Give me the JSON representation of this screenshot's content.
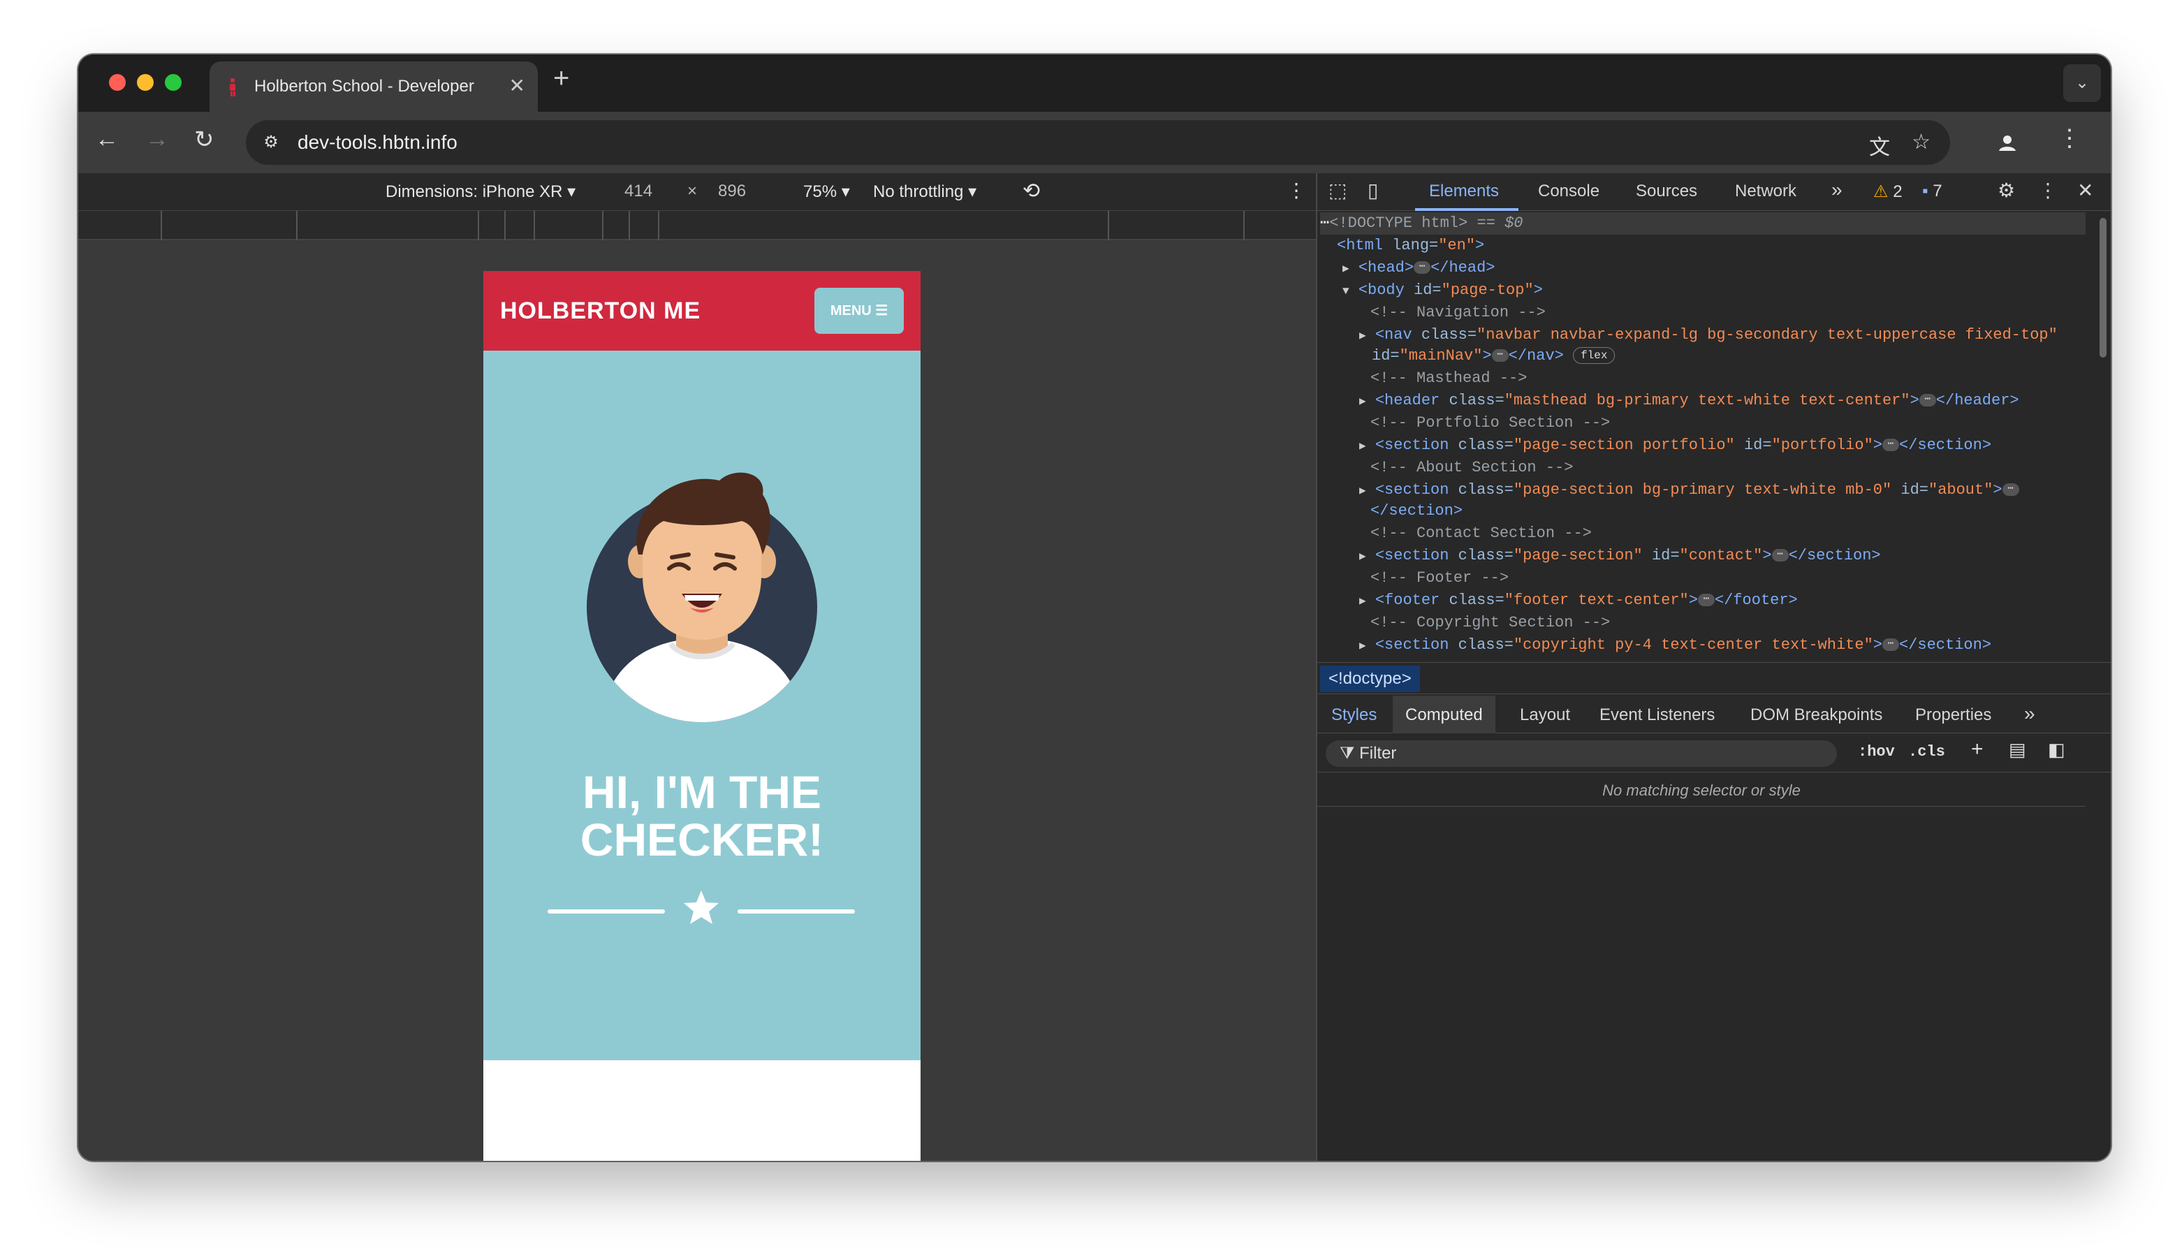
{
  "browser": {
    "tab_title": "Holberton School - Developer",
    "tab_close": "✕",
    "new_tab": "+",
    "url": "dev-tools.hbtn.info"
  },
  "emulation": {
    "dimensions": "Dimensions: iPhone XR ▾",
    "width": "414",
    "times": "×",
    "height": "896",
    "zoom": "75% ▾",
    "throttling": "No throttling ▾"
  },
  "page": {
    "brand": "HOLBERTON ME",
    "menu": "MENU ☰",
    "hero_line1": "HI, I'M THE",
    "hero_line2": "CHECKER!"
  },
  "devtools": {
    "tabs": [
      "Elements",
      "Console",
      "Sources",
      "Network"
    ],
    "more": "»",
    "warnings": "2",
    "issues": "7",
    "breadcrumb": "<!doctype>",
    "subtabs": [
      "Styles",
      "Computed",
      "Layout",
      "Event Listeners",
      "DOM Breakpoints",
      "Properties"
    ],
    "filter_placeholder": "Filter",
    "hov": ":hov",
    "cls": ".cls",
    "no_match": "No matching selector or style",
    "dom": {
      "doctype": "<!DOCTYPE html>",
      "selected_marker": " == $0",
      "html_tag": "<html",
      "html_attr": " lang=",
      "html_val": "\"en\"",
      "head": "<head>",
      "head_close": "</head>",
      "body_tag": "<body",
      "body_attr": " id=",
      "body_val": "\"page-top\"",
      "c_nav": "<!-- Navigation -->",
      "nav_tag": "<nav",
      "nav_attr": " class=",
      "nav_val": "\"navbar navbar-expand-lg bg-secondary text-uppercase fixed-top\"",
      "nav_attr2": "id=",
      "nav_val2": "\"mainNav\"",
      "nav_close": "</nav>",
      "flex": "flex",
      "c_mast": "<!-- Masthead -->",
      "header_tag": "<header",
      "header_attr": " class=",
      "header_val": "\"masthead bg-primary text-white text-center\"",
      "header_close": "</header>",
      "c_port": "<!-- Portfolio Section -->",
      "port_tag": "<section",
      "port_attr": " class=",
      "port_val": "\"page-section portfolio\"",
      "port_attr2": " id=",
      "port_val2": "\"portfolio\"",
      "section_close": "</section>",
      "c_about": "<!-- About Section -->",
      "about_tag": "<section",
      "about_attr": " class=",
      "about_val": "\"page-section bg-primary text-white mb-0\"",
      "about_attr2": " id=",
      "about_val2": "\"about\"",
      "about_close": "</section>",
      "c_contact": "<!-- Contact Section -->",
      "contact_tag": "<section",
      "contact_attr": " class=",
      "contact_val": "\"page-section\"",
      "contact_attr2": " id=",
      "contact_val2": "\"contact\"",
      "c_footer": "<!-- Footer -->",
      "footer_tag": "<footer",
      "footer_attr": " class=",
      "footer_val": "\"footer text-center\"",
      "footer_close": "</footer>",
      "c_copy": "<!-- Copyright Section -->",
      "copy_tag": "<section",
      "copy_attr": " class=",
      "copy_val": "\"copyright py-4 text-center text-white\""
    }
  },
  "colors": {
    "navbar": "#d0283f",
    "masthead": "#8fcad3",
    "menu_button": "#8dc7cf",
    "devtools_accent": "#8ab4f8"
  }
}
